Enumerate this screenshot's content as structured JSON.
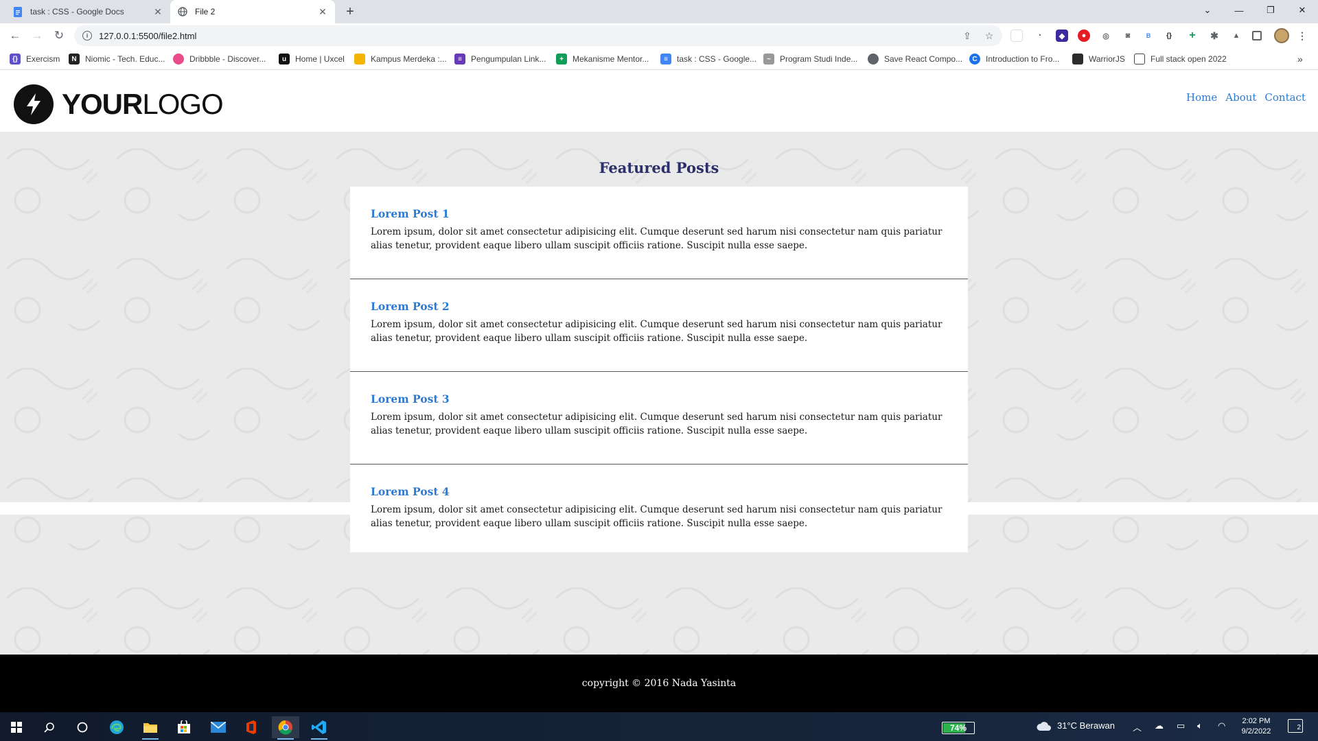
{
  "browser": {
    "tabs": [
      {
        "title": "task : CSS - Google Docs",
        "active": false
      },
      {
        "title": "File 2",
        "active": true
      }
    ],
    "url": "127.0.0.1:5500/file2.html",
    "bookmarks": [
      {
        "label": "Exercism",
        "color": "#604fcd"
      },
      {
        "label": "Niomic - Tech. Educ...",
        "color": "#222222"
      },
      {
        "label": "Dribbble - Discover...",
        "color": "#ea4c89"
      },
      {
        "label": "Home | Uxcel",
        "color": "#111111"
      },
      {
        "label": "Kampus Merdeka :...",
        "color": "#f5b400"
      },
      {
        "label": "Pengumpulan Link...",
        "color": "#673ab7"
      },
      {
        "label": "Mekanisme Mentor...",
        "color": "#0f9d58"
      },
      {
        "label": "task : CSS - Google...",
        "color": "#4285f4"
      },
      {
        "label": "Program Studi Inde...",
        "color": "#666666"
      },
      {
        "label": "Save React Compo...",
        "color": "#5f6368"
      },
      {
        "label": "Introduction to Fro...",
        "color": "#1a73e8"
      },
      {
        "label": "WarriorJS",
        "color": "#2b2b2b"
      },
      {
        "label": "Full stack open 2022",
        "color": "#444444"
      }
    ]
  },
  "site": {
    "logo": {
      "bold": "YOUR",
      "light": "LOGO"
    },
    "nav": [
      "Home",
      "About",
      "Contact"
    ],
    "section_title": "Featured Posts",
    "posts": [
      {
        "title": "Lorem Post 1",
        "body": "Lorem ipsum, dolor sit amet consectetur adipisicing elit. Cumque deserunt sed harum nisi consectetur nam quis pariatur alias tenetur, provident eaque libero ullam suscipit officiis ratione. Suscipit nulla esse saepe."
      },
      {
        "title": "Lorem Post 2",
        "body": "Lorem ipsum, dolor sit amet consectetur adipisicing elit. Cumque deserunt sed harum nisi consectetur nam quis pariatur alias tenetur, provident eaque libero ullam suscipit officiis ratione. Suscipit nulla esse saepe."
      },
      {
        "title": "Lorem Post 3",
        "body": "Lorem ipsum, dolor sit amet consectetur adipisicing elit. Cumque deserunt sed harum nisi consectetur nam quis pariatur alias tenetur, provident eaque libero ullam suscipit officiis ratione. Suscipit nulla esse saepe."
      },
      {
        "title": "Lorem Post 4",
        "body": "Lorem ipsum, dolor sit amet consectetur adipisicing elit. Cumque deserunt sed harum nisi consectetur nam quis pariatur alias tenetur, provident eaque libero ullam suscipit officiis ratione. Suscipit nulla esse saepe."
      }
    ],
    "footer": "copyright © 2016 Nada Yasinta",
    "colors": {
      "link": "#2b7bd6",
      "heading": "#2b2f6b",
      "footer_bg": "#000000"
    }
  },
  "taskbar": {
    "battery": "74%",
    "battery_level": 0.74,
    "weather": "31°C  Berawan",
    "time": "2:02 PM",
    "date": "9/2/2022",
    "notifications": "2"
  }
}
